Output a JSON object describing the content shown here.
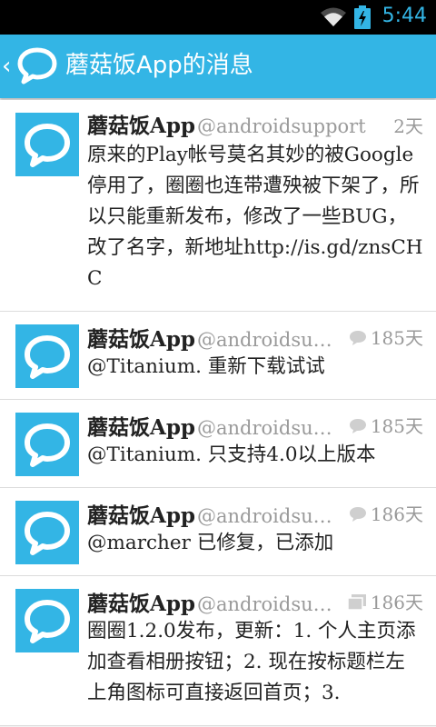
{
  "status_bar": {
    "time": "5:44"
  },
  "action_bar": {
    "back": "‹",
    "title": "蘑菇饭App的消息"
  },
  "colors": {
    "accent": "#33b5e5",
    "avatar": "#33b5e5"
  },
  "messages": [
    {
      "name": "蘑菇饭App",
      "handle": "@androidsupport",
      "time": "2天",
      "meta_icon": "none",
      "text": "原来的Play帐号莫名其妙的被Google停用了，圈圈也连带遭殃被下架了，所以只能重新发布，修改了一些BUG，改了名字，新地址http://is.gd/znsCHC"
    },
    {
      "name": "蘑菇饭App",
      "handle": "@androidsupport",
      "time": "185天",
      "meta_icon": "comment-icon",
      "text": "@Titanium. 重新下载试试"
    },
    {
      "name": "蘑菇饭App",
      "handle": "@androidsupport",
      "time": "185天",
      "meta_icon": "comment-icon",
      "text": "@Titanium. 只支持4.0以上版本"
    },
    {
      "name": "蘑菇饭App",
      "handle": "@androidsupport",
      "time": "186天",
      "meta_icon": "comment-icon",
      "text": "@marcher 已修复，已添加"
    },
    {
      "name": "蘑菇饭App",
      "handle": "@androidsupport",
      "time": "186天",
      "meta_icon": "album-icon",
      "text": "圈圈1.2.0发布，更新：1. 个人主页添加查看相册按钮；2. 现在按标题栏左上角图标可直接返回首页；3."
    }
  ]
}
